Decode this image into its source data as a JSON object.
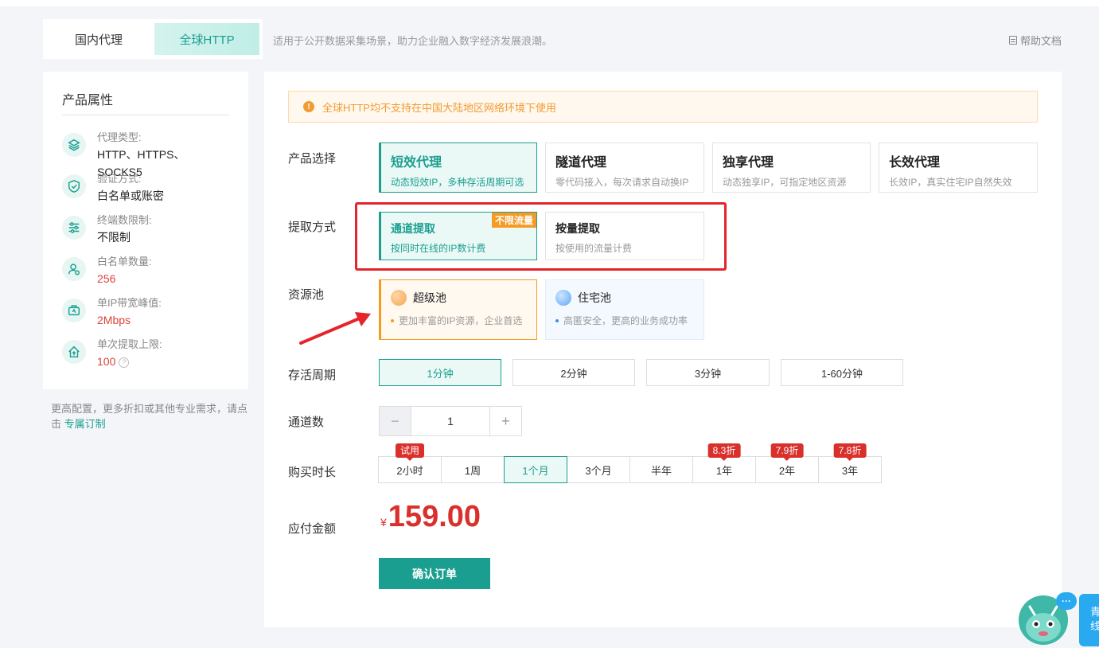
{
  "tabs": [
    {
      "label": "国内代理",
      "active": false
    },
    {
      "label": "全球HTTP",
      "active": true
    }
  ],
  "header": {
    "description": "适用于公开数据采集场景，助力企业融入数字经济发展浪潮。",
    "help_label": "帮助文档"
  },
  "attributes": {
    "title": "产品属性",
    "items": [
      {
        "icon": "layers-icon",
        "label": "代理类型:",
        "value": "HTTP、HTTPS、SOCKS5",
        "red": false
      },
      {
        "icon": "shield-check-icon",
        "label": "验证方式:",
        "value": "白名单或账密",
        "red": false
      },
      {
        "icon": "sliders-icon",
        "label": "终端数限制:",
        "value": "不限制",
        "red": false
      },
      {
        "icon": "user-list-icon",
        "label": "白名单数量:",
        "value": "256",
        "red": true
      },
      {
        "icon": "bandwidth-icon",
        "label": "单IP带宽峰值:",
        "value": "2Mbps",
        "red": true
      },
      {
        "icon": "upload-home-icon",
        "label": "单次提取上限:",
        "value": "100",
        "red": true
      }
    ],
    "note_text": "更高配置，更多折扣或其他专业需求，请点击",
    "note_link": "专属订制"
  },
  "warning": "全球HTTP均不支持在中国大陆地区网络环境下使用",
  "labels": {
    "product": "产品选择",
    "extract": "提取方式",
    "pool": "资源池",
    "ttl": "存活周期",
    "channels": "通道数",
    "duration": "购买时长",
    "amount": "应付金额"
  },
  "products": [
    {
      "title": "短效代理",
      "desc": "动态短效IP，多种存活周期可选",
      "selected": true
    },
    {
      "title": "隧道代理",
      "desc": "零代码接入，每次请求自动换IP",
      "selected": false
    },
    {
      "title": "独享代理",
      "desc": "动态独享IP，可指定地区资源",
      "selected": false
    },
    {
      "title": "长效代理",
      "desc": "长效IP，真实住宅IP自然失效",
      "selected": false
    }
  ],
  "extract_methods": [
    {
      "title": "通道提取",
      "desc": "按同时在线的IP数计费",
      "selected": true,
      "tag": "不限流量"
    },
    {
      "title": "按量提取",
      "desc": "按使用的流量计费",
      "selected": false,
      "tag": ""
    }
  ],
  "pools": [
    {
      "title": "超级池",
      "desc": "更加丰富的IP资源，企业首选",
      "selected": true
    },
    {
      "title": "住宅池",
      "desc": "高匿安全，更高的业务成功率",
      "selected": false
    }
  ],
  "ttl_options": [
    {
      "label": "1分钟",
      "selected": true
    },
    {
      "label": "2分钟",
      "selected": false
    },
    {
      "label": "3分钟",
      "selected": false
    },
    {
      "label": "1-60分钟",
      "selected": false
    }
  ],
  "channels": {
    "value": "1",
    "minus": "−",
    "plus": "+"
  },
  "durations": [
    {
      "label": "2小时",
      "badge": "试用",
      "selected": false
    },
    {
      "label": "1周",
      "badge": "",
      "selected": false
    },
    {
      "label": "1个月",
      "badge": "",
      "selected": true
    },
    {
      "label": "3个月",
      "badge": "",
      "selected": false
    },
    {
      "label": "半年",
      "badge": "",
      "selected": false
    },
    {
      "label": "1年",
      "badge": "8.3折",
      "selected": false
    },
    {
      "label": "2年",
      "badge": "7.9折",
      "selected": false
    },
    {
      "label": "3年",
      "badge": "7.8折",
      "selected": false
    }
  ],
  "price": {
    "currency": "¥",
    "amount": "159.00"
  },
  "confirm_label": "确认订单",
  "chat": {
    "bubble": "···",
    "side_text": "青\n线"
  },
  "colors": {
    "accent": "#1a9e8f",
    "price": "#d9302c",
    "warning": "#f29b33",
    "annotation": "#e5242b"
  }
}
